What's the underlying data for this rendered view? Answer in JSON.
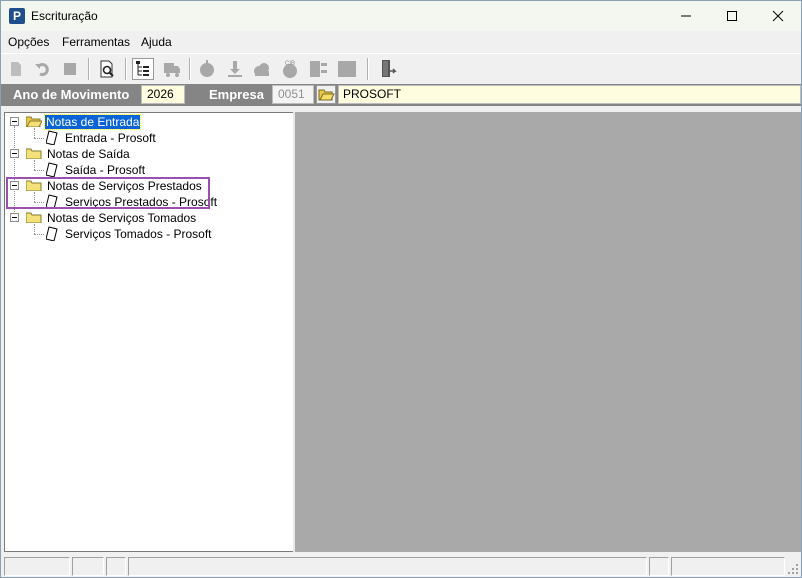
{
  "window": {
    "title": "Escrituração",
    "app_icon_letter": "P",
    "controls": [
      "minimize-icon",
      "maximize-icon",
      "close-icon"
    ]
  },
  "menu": {
    "items": [
      "Opções",
      "Ferramentas",
      "Ajuda"
    ]
  },
  "toolbar": {
    "icons": [
      "new-doc-icon",
      "undo-icon",
      "stop-icon",
      "print-preview-icon",
      "tree-view-icon",
      "truck-icon",
      "apple-icon",
      "download-icon",
      "cloud-icon",
      "cib-icon",
      "panel-icon",
      "square-icon",
      "exit-door-icon"
    ]
  },
  "params": {
    "year_label": "Ano de Movimento",
    "year_value": "2026",
    "company_label": "Empresa",
    "company_code": "0051",
    "company_name": "PROSOFT"
  },
  "tree": {
    "groups": [
      {
        "label": "Notas de Entrada",
        "child": "Entrada - Prosoft",
        "selected": true
      },
      {
        "label": "Notas de Saída",
        "child": "Saída - Prosoft",
        "selected": false
      },
      {
        "label": "Notas de Serviços Prestados",
        "child": "Serviços Prestados - Prosoft",
        "selected": false
      },
      {
        "label": "Notas de Serviços Tomados",
        "child": "Serviços Tomados - Prosoft",
        "selected": false
      }
    ],
    "highlight_color": "#9b4fb0"
  }
}
